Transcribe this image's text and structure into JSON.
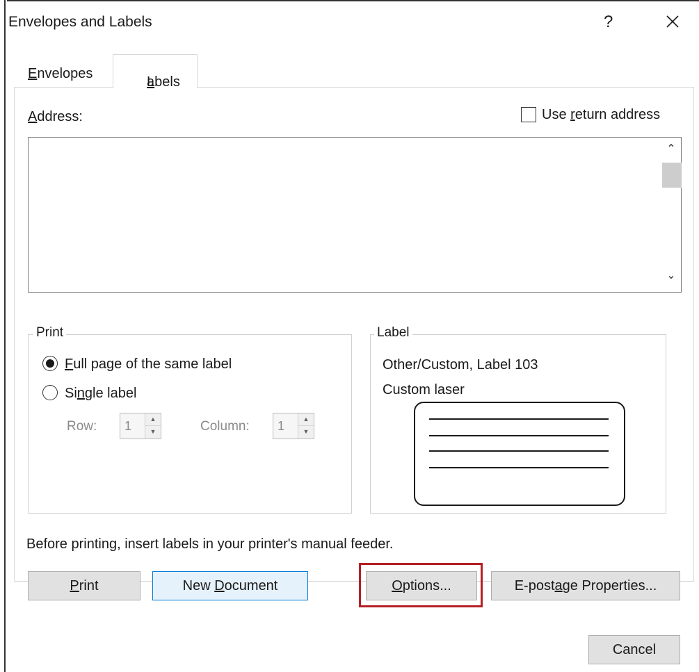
{
  "window": {
    "title": "Envelopes and Labels",
    "help_label": "?"
  },
  "tabs": [
    {
      "label": "Envelopes",
      "accel": "E",
      "rest": "nvelopes",
      "selected": false
    },
    {
      "label": "Labels",
      "accel": "L",
      "rest": "abels",
      "selected": true
    }
  ],
  "address": {
    "label_accel": "A",
    "label_rest": "ddress:",
    "value": "",
    "use_return_address": {
      "before": "Use ",
      "accel": "r",
      "after": "eturn address",
      "checked": false
    }
  },
  "print_group": {
    "title": "Print",
    "full_page": {
      "accel": "F",
      "rest": "ull page of the same label",
      "selected": true
    },
    "single_label": {
      "before": "Si",
      "accel": "n",
      "after": "gle label",
      "selected": false
    },
    "row_label": "Row:",
    "row_value": "1",
    "column_label": "Column:",
    "column_value": "1"
  },
  "label_group": {
    "title": "Label",
    "line1": "Other/Custom, Label 103",
    "line2": "Custom laser"
  },
  "note": "Before printing, insert labels in your printer's manual feeder.",
  "buttons": {
    "print": {
      "accel": "P",
      "rest": "rint"
    },
    "new_document": {
      "before": "New ",
      "accel": "D",
      "after": "ocument"
    },
    "options": {
      "before": "",
      "accel": "O",
      "after": "ptions..."
    },
    "epostage": {
      "before": "E-post",
      "accel": "a",
      "after": "ge Properties..."
    },
    "cancel": "Cancel"
  },
  "colors": {
    "highlight": "#b51f24",
    "default_button_border": "#0078d7",
    "default_button_fill": "#e5f1fb"
  },
  "icons": [
    "close-icon",
    "scroll-up-icon",
    "scroll-down-icon",
    "radio-selected-icon",
    "spin-up-icon",
    "spin-down-icon"
  ]
}
